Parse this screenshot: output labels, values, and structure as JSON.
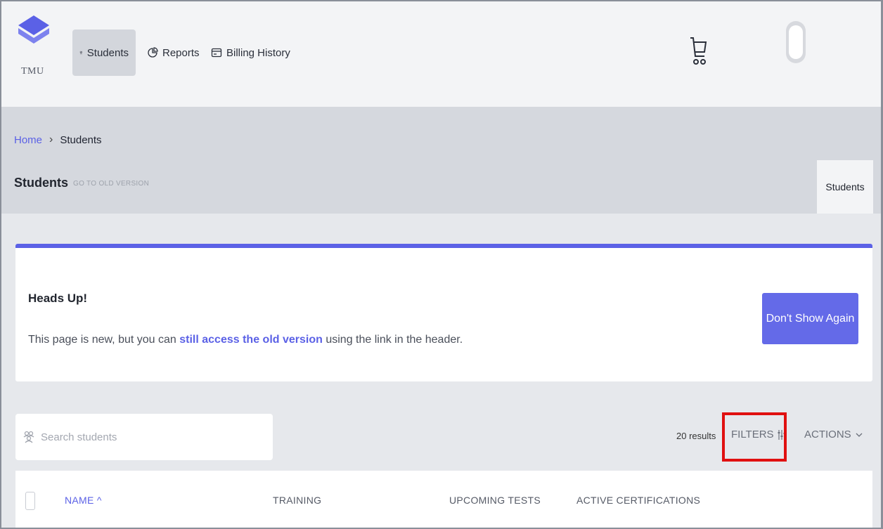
{
  "app": {
    "logo_text": "TMU"
  },
  "nav": {
    "items": [
      {
        "label": "Students",
        "icon": "students-icon",
        "active": true
      },
      {
        "label": "Reports",
        "icon": "reports-icon",
        "active": false
      },
      {
        "label": "Billing History",
        "icon": "billing-icon",
        "active": false
      }
    ]
  },
  "breadcrumb": {
    "home": "Home",
    "separator": "›",
    "current": "Students"
  },
  "page": {
    "title": "Students",
    "old_version_link": "GO TO OLD VERSION",
    "tab": "Students"
  },
  "alert": {
    "title": "Heads Up!",
    "body_before": "This page is new, but you can ",
    "body_link": "still access the old version",
    "body_after": " using the link in the header.",
    "button": "Don't Show Again"
  },
  "search": {
    "placeholder": "Search students",
    "value": ""
  },
  "toolbar": {
    "results": "20 results",
    "filters": "FILTERS",
    "actions": "ACTIONS"
  },
  "table": {
    "columns": [
      "NAME ^",
      "TRAINING",
      "UPCOMING TESTS",
      "ACTIVE CERTIFICATIONS"
    ]
  },
  "colors": {
    "accent": "#5b61e6",
    "highlight": "#e01010",
    "header_bg": "#d5d8de"
  }
}
